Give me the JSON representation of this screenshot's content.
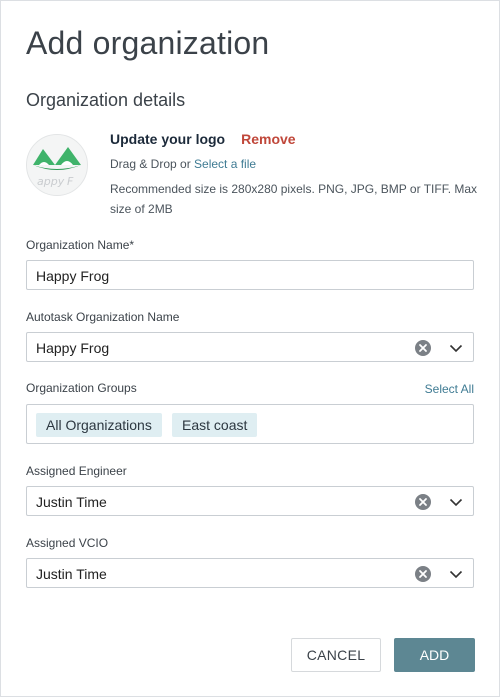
{
  "dialog": {
    "title": "Add organization",
    "section_title": "Organization details"
  },
  "logo": {
    "heading": "Update your logo",
    "remove_label": "Remove",
    "drag_drop_text": "Drag & Drop or ",
    "select_file_link": "Select a file",
    "recommendation": "Recommended size is 280x280 pixels. PNG, JPG, BMP or TIFF. Max size of 2MB",
    "image_icon": "happy-frog-logo"
  },
  "fields": {
    "org_name": {
      "label": "Organization Name*",
      "value": "Happy Frog"
    },
    "autotask_name": {
      "label": "Autotask Organization Name",
      "value": "Happy Frog"
    },
    "org_groups": {
      "label": "Organization Groups",
      "select_all_label": "Select All",
      "tags": [
        "All Organizations",
        "East coast"
      ]
    },
    "engineer": {
      "label": "Assigned Engineer",
      "value": "Justin Time"
    },
    "vcio": {
      "label": "Assigned VCIO",
      "value": "Justin Time"
    }
  },
  "actions": {
    "cancel_label": "CANCEL",
    "add_label": "ADD"
  },
  "colors": {
    "accent": "#5d8793",
    "link": "#3f7b93",
    "danger": "#c0473a",
    "tag_bg": "#dfeef2"
  }
}
